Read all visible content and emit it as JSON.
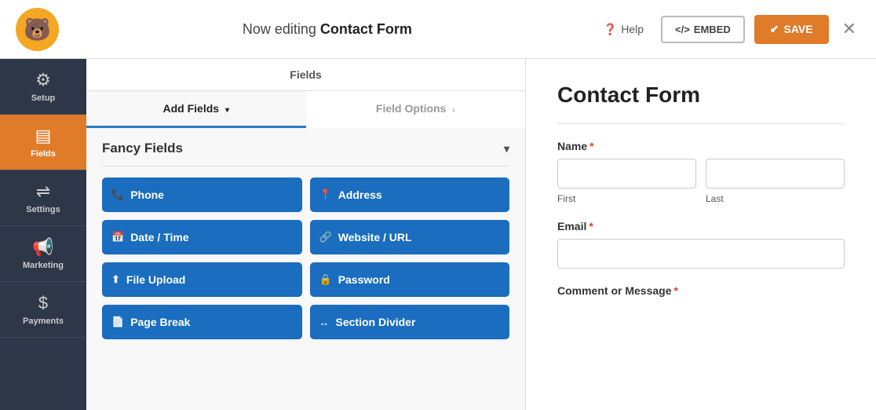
{
  "topbar": {
    "editing_label": "Now editing ",
    "form_name": "Contact Form",
    "help_label": "Help",
    "embed_label": "<​/> EMBED",
    "save_label": "✔ SAVE",
    "close_symbol": "✕"
  },
  "sidebar": {
    "items": [
      {
        "id": "setup",
        "label": "Setup",
        "icon": "⚙"
      },
      {
        "id": "fields",
        "label": "Fields",
        "icon": "☰",
        "active": true
      },
      {
        "id": "settings",
        "label": "Settings",
        "icon": "⇌"
      },
      {
        "id": "marketing",
        "label": "Marketing",
        "icon": "📢"
      },
      {
        "id": "payments",
        "label": "Payments",
        "icon": "$"
      }
    ]
  },
  "fields_panel": {
    "header": "Fields",
    "tabs": [
      {
        "id": "add-fields",
        "label": "Add Fields",
        "active": true,
        "chevron": "▾"
      },
      {
        "id": "field-options",
        "label": "Field Options",
        "active": false,
        "chevron": "›"
      }
    ],
    "fancy_fields_label": "Fancy Fields",
    "buttons": [
      {
        "id": "phone",
        "label": "Phone",
        "icon": "📞"
      },
      {
        "id": "address",
        "label": "Address",
        "icon": "📍"
      },
      {
        "id": "date-time",
        "label": "Date / Time",
        "icon": "📅"
      },
      {
        "id": "website-url",
        "label": "Website / URL",
        "icon": "🔗"
      },
      {
        "id": "file-upload",
        "label": "File Upload",
        "icon": "⬆"
      },
      {
        "id": "password",
        "label": "Password",
        "icon": "🔒"
      },
      {
        "id": "page-break",
        "label": "Page Break",
        "icon": "📄"
      },
      {
        "id": "section-divider",
        "label": "Section Divider",
        "icon": "↔"
      }
    ]
  },
  "form_preview": {
    "title": "Contact Form",
    "name_label": "Name",
    "name_required": "*",
    "first_label": "First",
    "last_label": "Last",
    "email_label": "Email",
    "email_required": "*",
    "comment_label": "Comment or Message",
    "comment_required": "*"
  },
  "colors": {
    "active_sidebar": "#e07b2a",
    "field_btn": "#1a6dbf",
    "save_btn": "#e07b2a",
    "required_star": "#e03e2d",
    "sidebar_bg": "#2d3748"
  }
}
